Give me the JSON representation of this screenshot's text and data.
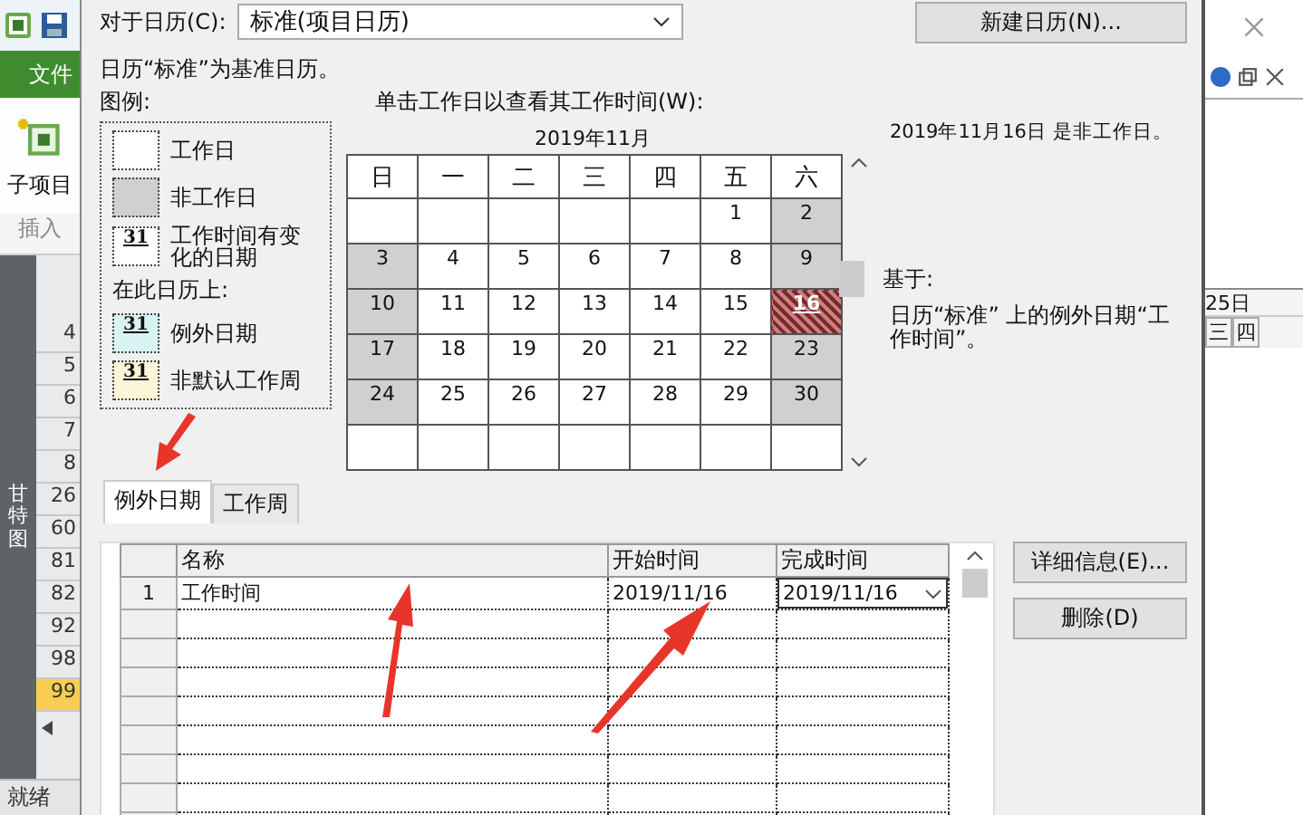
{
  "app": {
    "file_tab": "文件",
    "ribbon_button": "子项目",
    "ribbon_group": "插入",
    "view_label": "甘特图",
    "row_numbers": [
      {
        "number": "4",
        "selected": false
      },
      {
        "number": "5",
        "selected": false
      },
      {
        "number": "6",
        "selected": false
      },
      {
        "number": "7",
        "selected": false
      },
      {
        "number": "8",
        "selected": false
      },
      {
        "number": "26",
        "selected": false
      },
      {
        "number": "60",
        "selected": false
      },
      {
        "number": "81",
        "selected": false
      },
      {
        "number": "82",
        "selected": false
      },
      {
        "number": "92",
        "selected": false
      },
      {
        "number": "98",
        "selected": false
      },
      {
        "number": "99",
        "selected": true
      }
    ],
    "status": "就绪"
  },
  "dialog": {
    "calendar_label": "对于日历(C):",
    "calendar_value": "标准(项目日历)",
    "new_button": "新建日历(N)...",
    "base_note": "日历“标准”为基准日历。",
    "legend": {
      "title": "图例:",
      "items": [
        {
          "kind": "working",
          "label": "工作日"
        },
        {
          "kind": "nonworking",
          "label": "非工作日"
        },
        {
          "kind": "changed",
          "swatch": "31",
          "label": "工作时间有变化的日期"
        },
        {
          "kind": "heading",
          "label": "在此日历上:"
        },
        {
          "kind": "exception",
          "swatch": "31",
          "label": "例外日期"
        },
        {
          "kind": "nondefault",
          "swatch": "31",
          "label": "非默认工作周"
        }
      ]
    },
    "calendar": {
      "label": "单击工作日以查看其工作时间(W):",
      "month": "2019年11月",
      "weekdays": [
        "日",
        "一",
        "二",
        "三",
        "四",
        "五",
        "六"
      ],
      "weeks": [
        [
          {
            "nonworking": false,
            "selected": false
          },
          {
            "nonworking": false,
            "selected": false
          },
          {
            "nonworking": false,
            "selected": false
          },
          {
            "nonworking": false,
            "selected": false
          },
          {
            "nonworking": false,
            "selected": false
          },
          {
            "day": "1",
            "nonworking": false,
            "selected": false
          },
          {
            "day": "2",
            "nonworking": true,
            "selected": false
          }
        ],
        [
          {
            "day": "3",
            "nonworking": true,
            "selected": false
          },
          {
            "day": "4",
            "nonworking": false,
            "selected": false
          },
          {
            "day": "5",
            "nonworking": false,
            "selected": false
          },
          {
            "day": "6",
            "nonworking": false,
            "selected": false
          },
          {
            "day": "7",
            "nonworking": false,
            "selected": false
          },
          {
            "day": "8",
            "nonworking": false,
            "selected": false
          },
          {
            "day": "9",
            "nonworking": true,
            "selected": false
          }
        ],
        [
          {
            "day": "10",
            "nonworking": true,
            "selected": false
          },
          {
            "day": "11",
            "nonworking": false,
            "selected": false
          },
          {
            "day": "12",
            "nonworking": false,
            "selected": false
          },
          {
            "day": "13",
            "nonworking": false,
            "selected": false
          },
          {
            "day": "14",
            "nonworking": false,
            "selected": false
          },
          {
            "day": "15",
            "nonworking": false,
            "selected": false
          },
          {
            "day": "16",
            "nonworking": true,
            "selected": true
          }
        ],
        [
          {
            "day": "17",
            "nonworking": true,
            "selected": false
          },
          {
            "day": "18",
            "nonworking": false,
            "selected": false
          },
          {
            "day": "19",
            "nonworking": false,
            "selected": false
          },
          {
            "day": "20",
            "nonworking": false,
            "selected": false
          },
          {
            "day": "21",
            "nonworking": false,
            "selected": false
          },
          {
            "day": "22",
            "nonworking": false,
            "selected": false
          },
          {
            "day": "23",
            "nonworking": true,
            "selected": false
          }
        ],
        [
          {
            "day": "24",
            "nonworking": true,
            "selected": false
          },
          {
            "day": "25",
            "nonworking": false,
            "selected": false
          },
          {
            "day": "26",
            "nonworking": false,
            "selected": false
          },
          {
            "day": "27",
            "nonworking": false,
            "selected": false
          },
          {
            "day": "28",
            "nonworking": false,
            "selected": false
          },
          {
            "day": "29",
            "nonworking": false,
            "selected": false
          },
          {
            "day": "30",
            "nonworking": true,
            "selected": false
          }
        ],
        [
          {
            "nonworking": false,
            "selected": false
          },
          {
            "nonworking": false,
            "selected": false
          },
          {
            "nonworking": false,
            "selected": false
          },
          {
            "nonworking": false,
            "selected": false
          },
          {
            "nonworking": false,
            "selected": false
          },
          {
            "nonworking": false,
            "selected": false
          },
          {
            "nonworking": false,
            "selected": false
          }
        ]
      ]
    },
    "info": {
      "status": "2019年11月16日 是非工作日。",
      "based_on_label": "基于:",
      "based_on_text": "日历“标准” 上的例外日期“工作时间”。"
    },
    "tabs": [
      {
        "label": "例外日期",
        "selected": true
      },
      {
        "label": "工作周",
        "selected": false
      }
    ],
    "exceptions": {
      "columns": [
        "名称",
        "开始时间",
        "完成时间"
      ],
      "rows": [
        {
          "index": "1",
          "name": "工作时间",
          "start": "2019/11/16",
          "finish": "2019/11/16",
          "editing": true
        }
      ]
    },
    "buttons": {
      "details": "详细信息(E)...",
      "delete": "删除(D)"
    }
  },
  "background_window": {
    "date_header": "25日",
    "weekdays": [
      "三",
      "四"
    ]
  }
}
